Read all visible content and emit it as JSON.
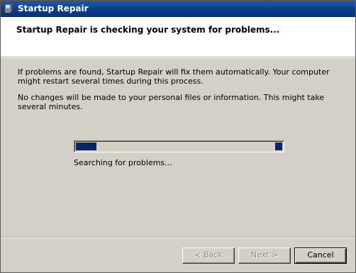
{
  "window": {
    "title": "Startup Repair",
    "colors": {
      "titlebar": "#0a3f8a",
      "progress": "#0a246a",
      "face": "#d4d0c8"
    }
  },
  "header": {
    "title": "Startup Repair is checking your system for problems..."
  },
  "body": {
    "paragraph1": "If problems are found, Startup Repair will fix them automatically. Your computer might restart several times during this process.",
    "paragraph2": "No changes will be made to your personal files or information. This might take several minutes."
  },
  "progress": {
    "fraction": 0.1,
    "status": "Searching for problems..."
  },
  "buttons": {
    "back": "< Back",
    "next": "Next >",
    "cancel": "Cancel"
  },
  "icons": {
    "app": "startup-repair-icon"
  }
}
